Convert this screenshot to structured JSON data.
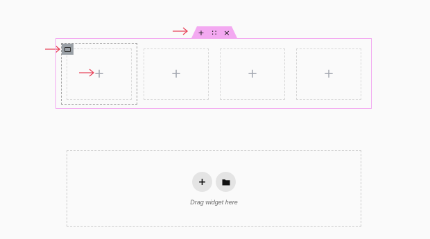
{
  "colors": {
    "accent_pink": "#f2a6f0",
    "handle_tab": "#f3a9f1",
    "annotation_arrow": "#e8435a",
    "column_handle": "#9aa0a6"
  },
  "section_handle": {
    "add_icon": "+",
    "drag_icon": "∷",
    "close_icon": "×"
  },
  "columns": [
    {
      "icon": "+"
    },
    {
      "icon": "+"
    },
    {
      "icon": "+"
    },
    {
      "icon": "+"
    }
  ],
  "drop_zone": {
    "add_icon": "+",
    "template_icon": "folder-icon",
    "label": "Drag widget here"
  }
}
